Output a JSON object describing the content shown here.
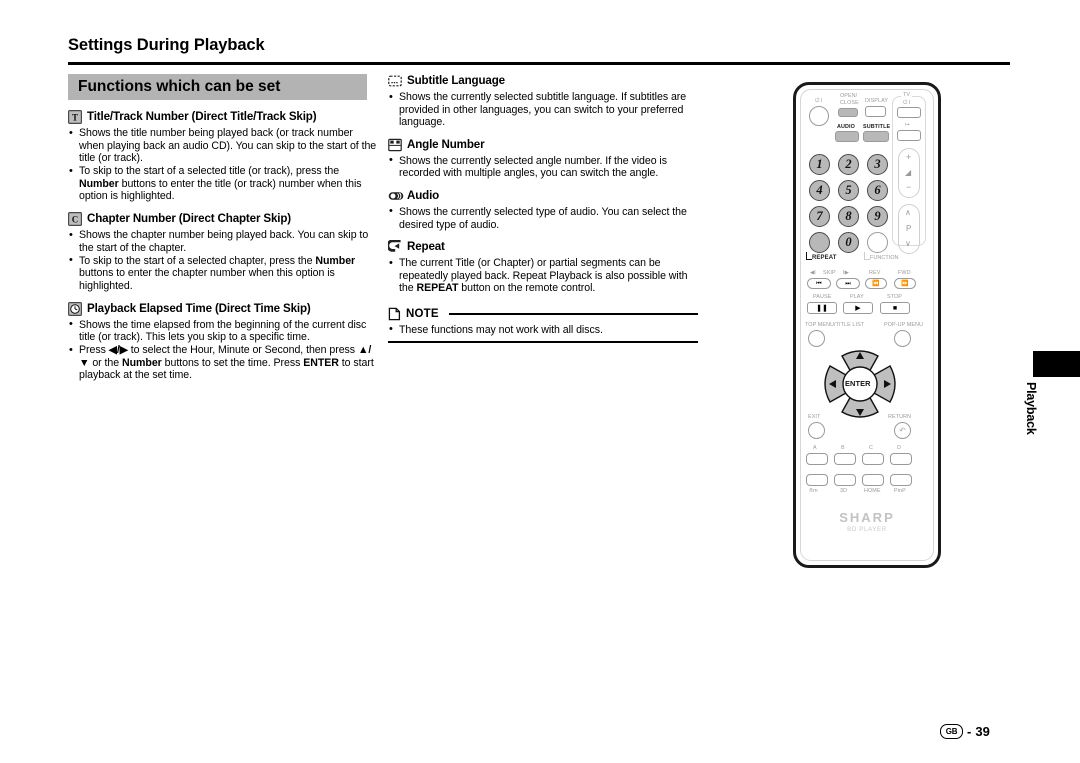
{
  "page": {
    "title": "Settings During Playback",
    "section_title": "Functions which can be set",
    "side_tab": "Playback",
    "footer_region": "GB",
    "footer_separator": "-",
    "footer_page": "39"
  },
  "left_column": [
    {
      "icon": "title-track-icon",
      "heading": "Title/Track Number (Direct Title/Track Skip)",
      "bullets": [
        [
          {
            "t": "Shows the title number being played back (or track number when playing back an audio CD). You can skip to the start of the title (or track)."
          }
        ],
        [
          {
            "t": "To skip to the start of a selected title (or track), press the "
          },
          {
            "t": "Number",
            "b": true
          },
          {
            "t": " buttons to enter the title (or track) number when this option is highlighted."
          }
        ]
      ]
    },
    {
      "icon": "chapter-icon",
      "heading": "Chapter Number (Direct Chapter Skip)",
      "bullets": [
        [
          {
            "t": "Shows the chapter number being played back. You can skip to the start of the chapter."
          }
        ],
        [
          {
            "t": "To skip to the start of a selected chapter, press the "
          },
          {
            "t": "Number",
            "b": true
          },
          {
            "t": " buttons to enter the chapter number when this option is highlighted."
          }
        ]
      ]
    },
    {
      "icon": "clock-icon",
      "heading": "Playback Elapsed Time (Direct Time Skip)",
      "bullets": [
        [
          {
            "t": "Shows the time elapsed from the beginning of the current disc title (or track). This lets you skip to a specific time."
          }
        ],
        [
          {
            "t": "Press "
          },
          {
            "t": "◀/▶",
            "b": true
          },
          {
            "t": " to select the Hour, Minute or Second, then press "
          },
          {
            "t": "▲/▼",
            "b": true
          },
          {
            "t": " or the "
          },
          {
            "t": "Number",
            "b": true
          },
          {
            "t": " buttons to set the time. Press "
          },
          {
            "t": "ENTER",
            "b": true
          },
          {
            "t": " to start playback at the set time."
          }
        ]
      ]
    }
  ],
  "mid_column": [
    {
      "icon": "subtitle-icon",
      "heading": "Subtitle Language",
      "bullets": [
        [
          {
            "t": "Shows the currently selected subtitle language. If subtitles are provided in other languages, you can switch to your preferred language."
          }
        ]
      ]
    },
    {
      "icon": "angle-icon",
      "heading": "Angle Number",
      "bullets": [
        [
          {
            "t": "Shows the currently selected angle number. If the video is recorded with multiple angles, you can switch the angle."
          }
        ]
      ]
    },
    {
      "icon": "audio-icon",
      "heading": "Audio",
      "bullets": [
        [
          {
            "t": "Shows the currently selected type of audio. You can select the desired type of audio."
          }
        ]
      ]
    },
    {
      "icon": "repeat-icon",
      "heading": "Repeat",
      "bullets": [
        [
          {
            "t": "The current Title (or Chapter) or partial segments can be repeatedly played back. Repeat Playback is also possible with the "
          },
          {
            "t": "REPEAT",
            "b": true
          },
          {
            "t": " button on the remote control."
          }
        ]
      ]
    }
  ],
  "note": {
    "icon": "note-page-icon",
    "label": "NOTE",
    "bullets": [
      [
        {
          "t": "These functions may not work with all discs."
        }
      ]
    ]
  },
  "remote": {
    "brand": "SHARP",
    "brand_sub": "BD PLAYER",
    "labels": {
      "power": "⏻ I",
      "open_close": "OPEN/\nCLOSE",
      "open_close_l1": "OPEN/",
      "open_close_l2": "CLOSE",
      "display": "DISPLAY",
      "tv": "TV",
      "tv_power": "⏻ I",
      "tv_input": "↦",
      "audio": "AUDIO",
      "subtitle": "SUBTITLE",
      "volume_plus": "+",
      "volume_minus": "−",
      "volume_icon": "◢",
      "channel": "P",
      "repeat": "REPEAT",
      "function": "FUNCTION",
      "skip": "SKIP",
      "skip_left": "◀I",
      "skip_right": "I▶",
      "rev": "REV",
      "fwd": "FWD",
      "pause": "PAUSE",
      "play": "PLAY",
      "stop": "STOP",
      "top_menu": "TOP MENU/TITLE LIST",
      "popup_menu": "POP-UP MENU",
      "exit": "EXIT",
      "return": "RETURN",
      "enter": "ENTER",
      "up": "▲",
      "down": "▼",
      "left": "◀",
      "right": "▶",
      "color_a": "A",
      "color_b": "B",
      "color_c": "C",
      "color_d": "D",
      "netflix": "®m",
      "three_d": "3D",
      "home": "HOME",
      "pinp": "PinP"
    },
    "numbers": [
      "1",
      "2",
      "3",
      "4",
      "5",
      "6",
      "7",
      "8",
      "9",
      "0"
    ]
  }
}
